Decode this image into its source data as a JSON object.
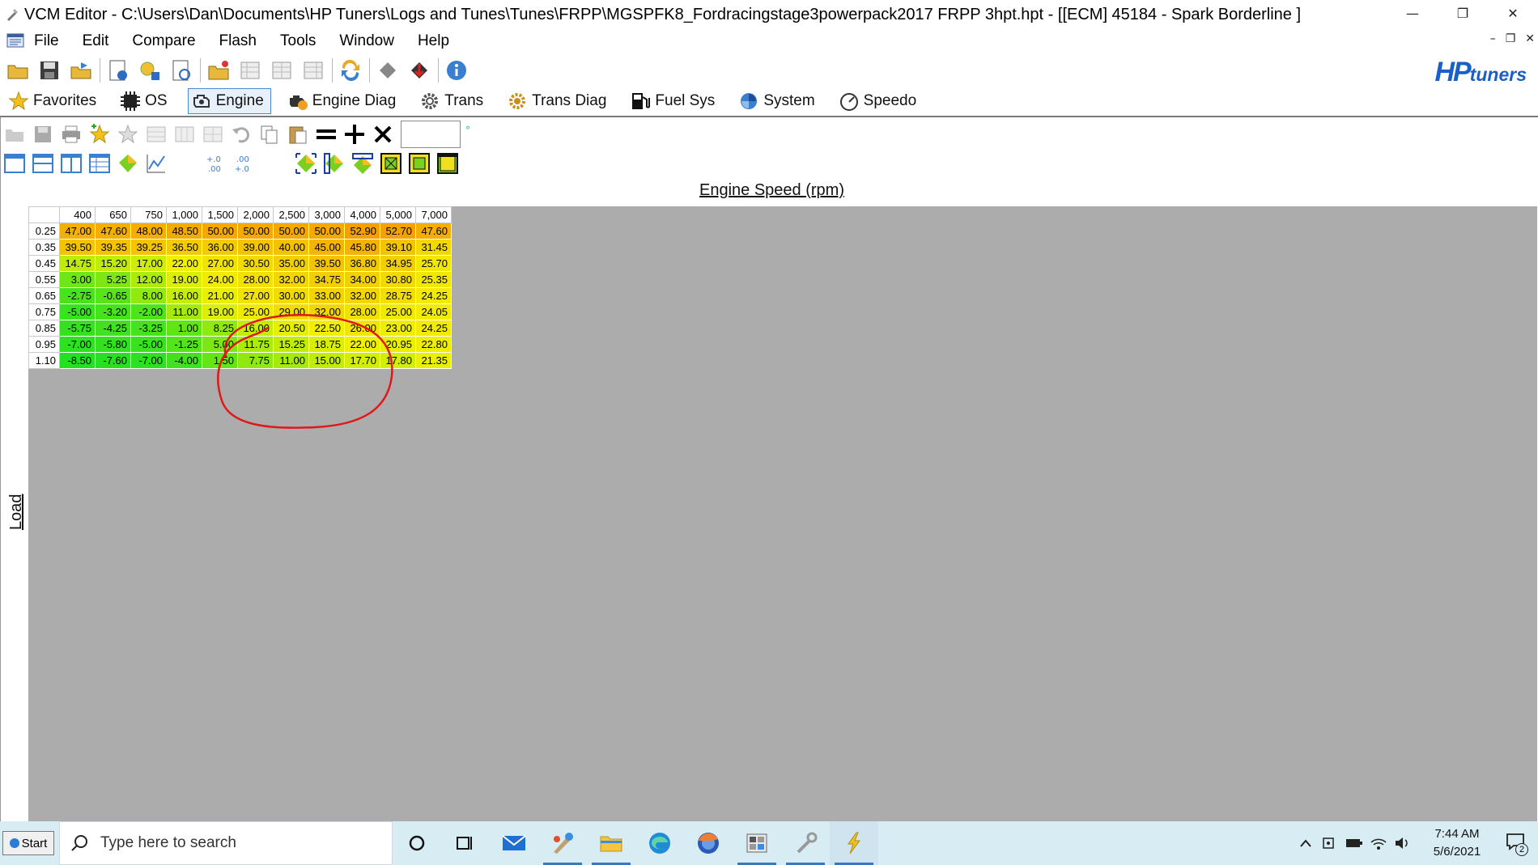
{
  "window": {
    "title": "VCM Editor - C:\\Users\\Dan\\Documents\\HP Tuners\\Logs and Tunes\\Tunes\\FRPP\\MGSPFK8_Fordracingstage3powerpack2017 FRPP 3hpt.hpt - [[ECM] 45184 - Spark Borderline ]",
    "controls": [
      "—",
      "❐",
      "✕"
    ]
  },
  "menu": {
    "items": [
      "File",
      "Edit",
      "Compare",
      "Flash",
      "Tools",
      "Window",
      "Help"
    ],
    "mdi_controls": [
      "–",
      "❐",
      "✕"
    ]
  },
  "logo": {
    "hp": "HP",
    "tuners": "tuners"
  },
  "tabs": [
    {
      "label": "Favorites",
      "icon": "star-icon",
      "active": false
    },
    {
      "label": "OS",
      "icon": "chip-icon",
      "active": false
    },
    {
      "label": "Engine",
      "icon": "engine-icon",
      "active": true
    },
    {
      "label": "Engine Diag",
      "icon": "engine-diag-icon",
      "active": false
    },
    {
      "label": "Trans",
      "icon": "gear-icon",
      "active": false
    },
    {
      "label": "Trans Diag",
      "icon": "trans-diag-icon",
      "active": false
    },
    {
      "label": "Fuel Sys",
      "icon": "fuel-pump-icon",
      "active": false
    },
    {
      "label": "System",
      "icon": "system-icon",
      "active": false
    },
    {
      "label": "Speedo",
      "icon": "speedometer-icon",
      "active": false
    }
  ],
  "table": {
    "x_axis_label": "Engine Speed (rpm)",
    "y_axis_label": "Load",
    "columns": [
      "400",
      "650",
      "750",
      "1,000",
      "1,500",
      "2,000",
      "2,500",
      "3,000",
      "4,000",
      "5,000",
      "7,000"
    ],
    "rows": [
      {
        "load": "0.25",
        "values": [
          "47.00",
          "47.60",
          "48.00",
          "48.50",
          "50.00",
          "50.00",
          "50.00",
          "50.00",
          "52.90",
          "52.70",
          "47.60"
        ]
      },
      {
        "load": "0.35",
        "values": [
          "39.50",
          "39.35",
          "39.25",
          "36.50",
          "36.00",
          "39.00",
          "40.00",
          "45.00",
          "45.80",
          "39.10",
          "31.45"
        ]
      },
      {
        "load": "0.45",
        "values": [
          "14.75",
          "15.20",
          "17.00",
          "22.00",
          "27.00",
          "30.50",
          "35.00",
          "39.50",
          "36.80",
          "34.95",
          "25.70"
        ]
      },
      {
        "load": "0.55",
        "values": [
          "3.00",
          "5.25",
          "12.00",
          "19.00",
          "24.00",
          "28.00",
          "32.00",
          "34.75",
          "34.00",
          "30.80",
          "25.35"
        ]
      },
      {
        "load": "0.65",
        "values": [
          "-2.75",
          "-0.65",
          "8.00",
          "16.00",
          "21.00",
          "27.00",
          "30.00",
          "33.00",
          "32.00",
          "28.75",
          "24.25"
        ]
      },
      {
        "load": "0.75",
        "values": [
          "-5.00",
          "-3.20",
          "-2.00",
          "11.00",
          "19.00",
          "25.00",
          "29.00",
          "32.00",
          "28.00",
          "25.00",
          "24.05"
        ]
      },
      {
        "load": "0.85",
        "values": [
          "-5.75",
          "-4.25",
          "-3.25",
          "1.00",
          "8.25",
          "16.00",
          "20.50",
          "22.50",
          "26.00",
          "23.00",
          "24.25"
        ]
      },
      {
        "load": "0.95",
        "values": [
          "-7.00",
          "-5.80",
          "-5.00",
          "-1.25",
          "5.00",
          "11.75",
          "15.25",
          "18.75",
          "22.00",
          "20.95",
          "22.80"
        ]
      },
      {
        "load": "1.10",
        "values": [
          "-8.50",
          "-7.60",
          "-7.00",
          "-4.00",
          "1.50",
          "7.75",
          "11.00",
          "15.00",
          "17.70",
          "17.80",
          "21.35"
        ]
      }
    ],
    "color_scale": {
      "low": "#22e022",
      "mid": "#f0f000",
      "high": "#f5a000"
    }
  },
  "value_input": {
    "value": "",
    "unit_mark": "°"
  },
  "taskbar": {
    "start_label": "Start",
    "search_placeholder": "Type here to search",
    "icons": [
      "cortana-icon",
      "task-view-icon",
      "mail-icon",
      "paint-icon",
      "file-explorer-icon",
      "edge-icon",
      "firefox-icon",
      "calculator-icon",
      "hp-tuners-scanner-icon",
      "vcm-editor-icon"
    ],
    "time": "7:44 AM",
    "date": "5/6/2021",
    "notification_count": "2"
  }
}
